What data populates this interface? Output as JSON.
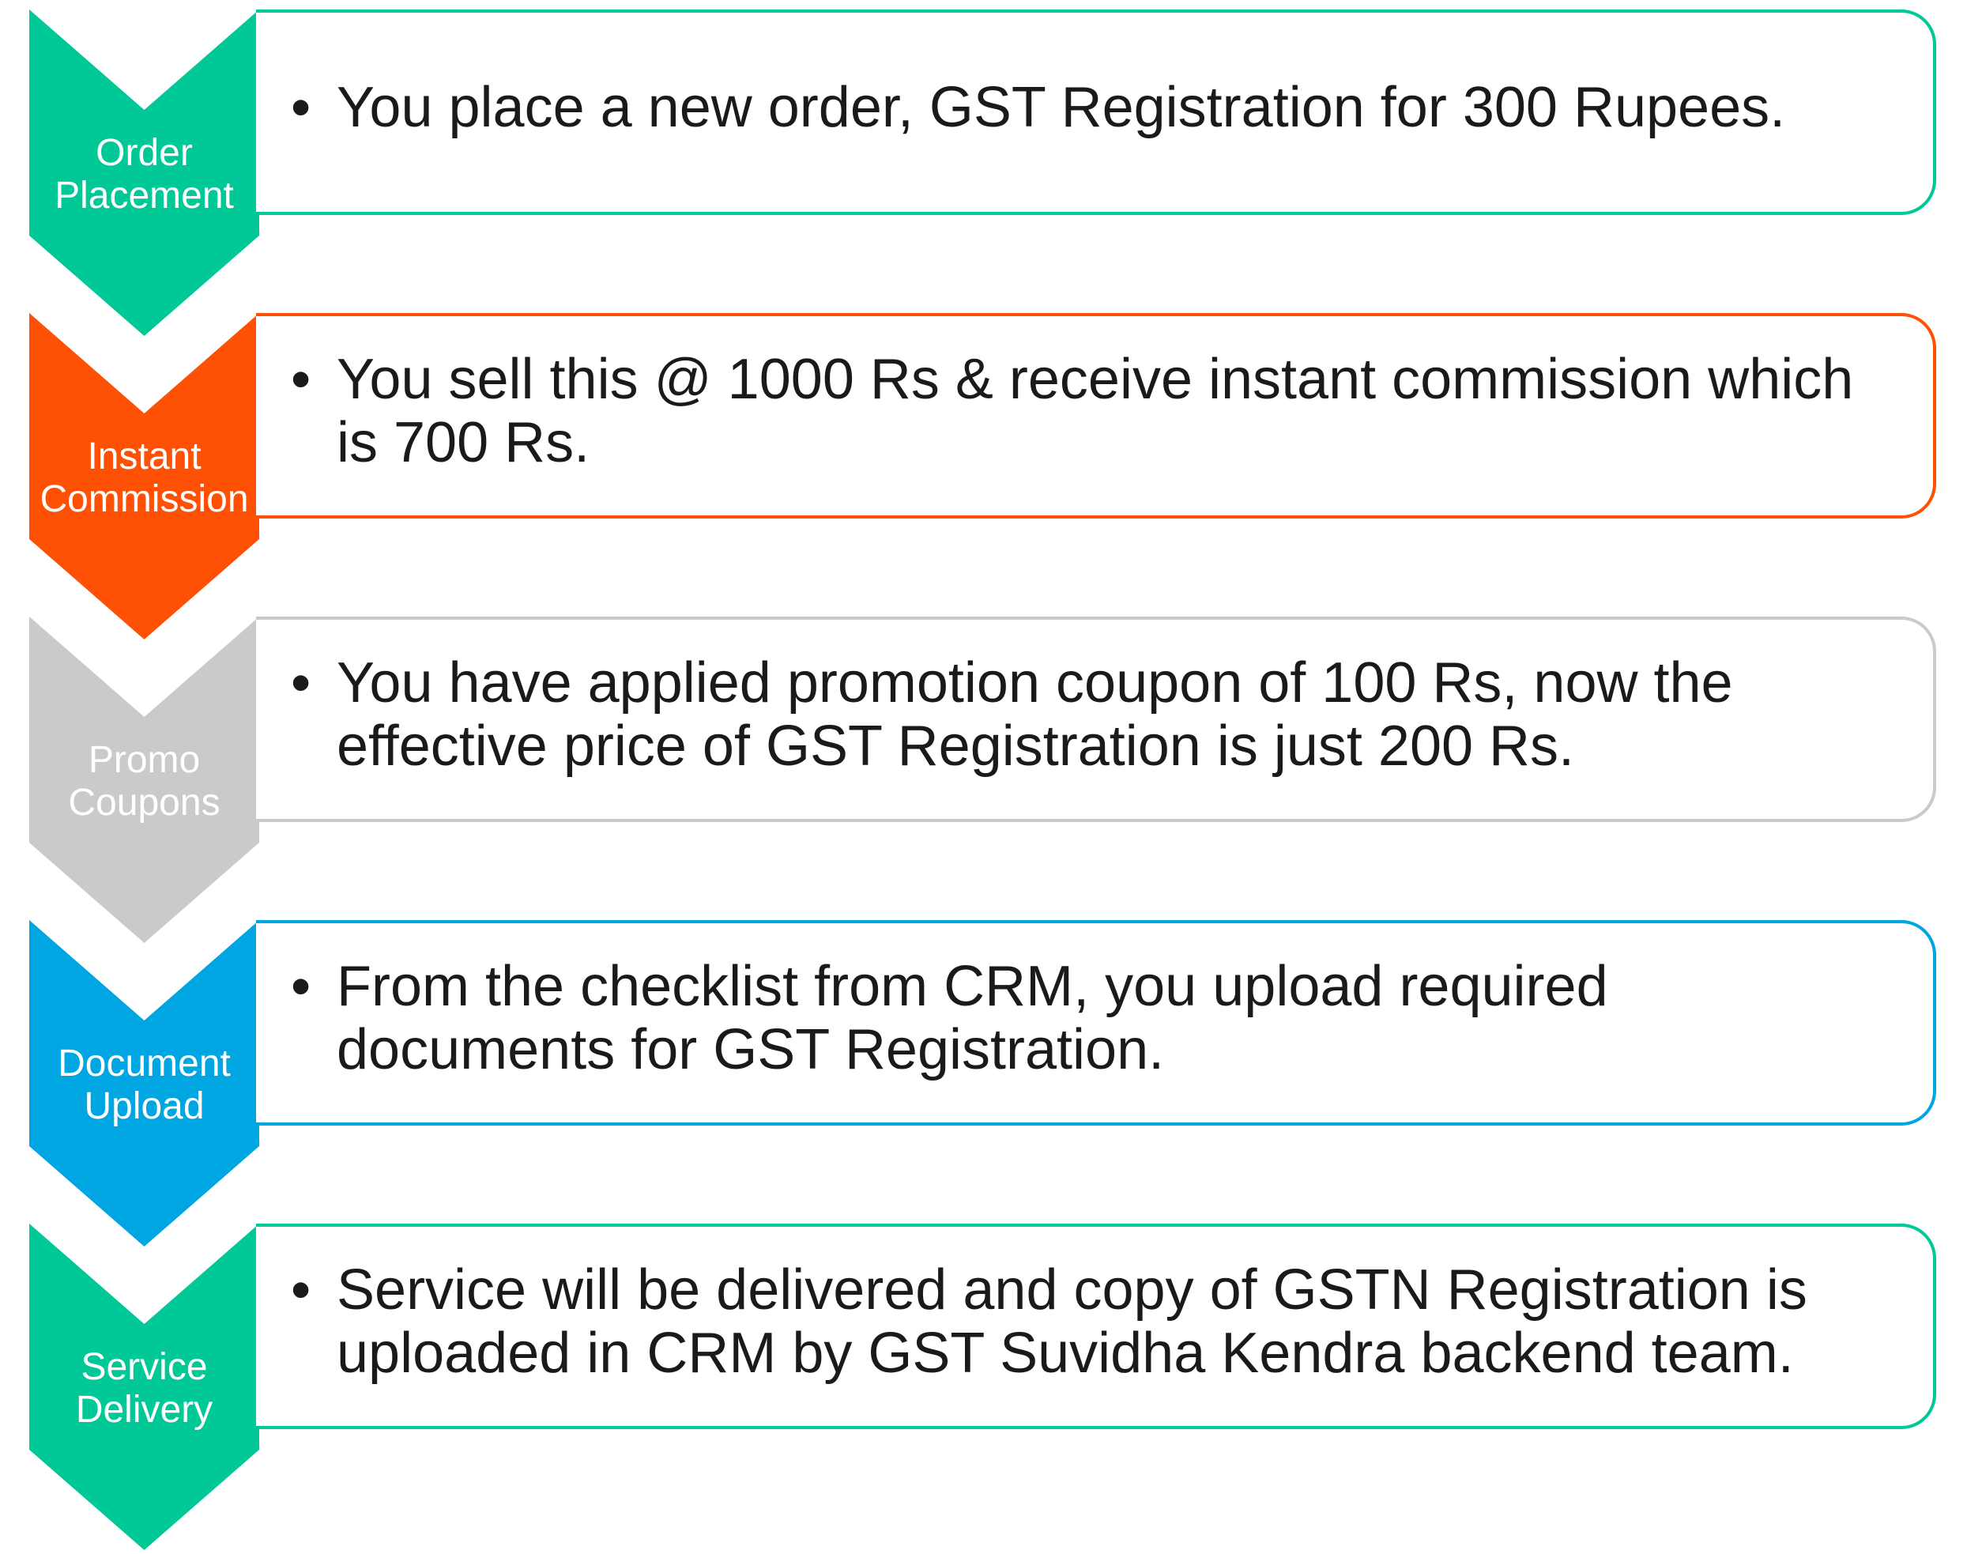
{
  "steps": [
    {
      "label_line1": "Order",
      "label_line2": "Placement",
      "text": "You place a new order, GST Registration for 300 Rupees.",
      "color": "#00C896",
      "label_color": "#ffffff"
    },
    {
      "label_line1": "Instant",
      "label_line2": "Commission",
      "text": "You sell this @ 1000 Rs & receive instant commission which is 700 Rs.",
      "color": "#FF5106",
      "label_color": "#ffffff"
    },
    {
      "label_line1": "Promo",
      "label_line2": "Coupons",
      "text": "You have applied promotion coupon of 100 Rs, now the effective price of GST Registration is just 200 Rs.",
      "color": "#CACACA",
      "label_color": "#ffffff"
    },
    {
      "label_line1": "Document",
      "label_line2": "Upload",
      "text": "From the checklist from CRM, you upload required documents for GST Registration.",
      "color": "#00A6E2",
      "label_color": "#ffffff"
    },
    {
      "label_line1": "Service",
      "label_line2": "Delivery",
      "text": "Service will be delivered and copy of GSTN Registration is uploaded in CRM by GST Suvidha Kendra backend team.",
      "color": "#00C896",
      "label_color": "#ffffff"
    }
  ],
  "bullet": "•"
}
